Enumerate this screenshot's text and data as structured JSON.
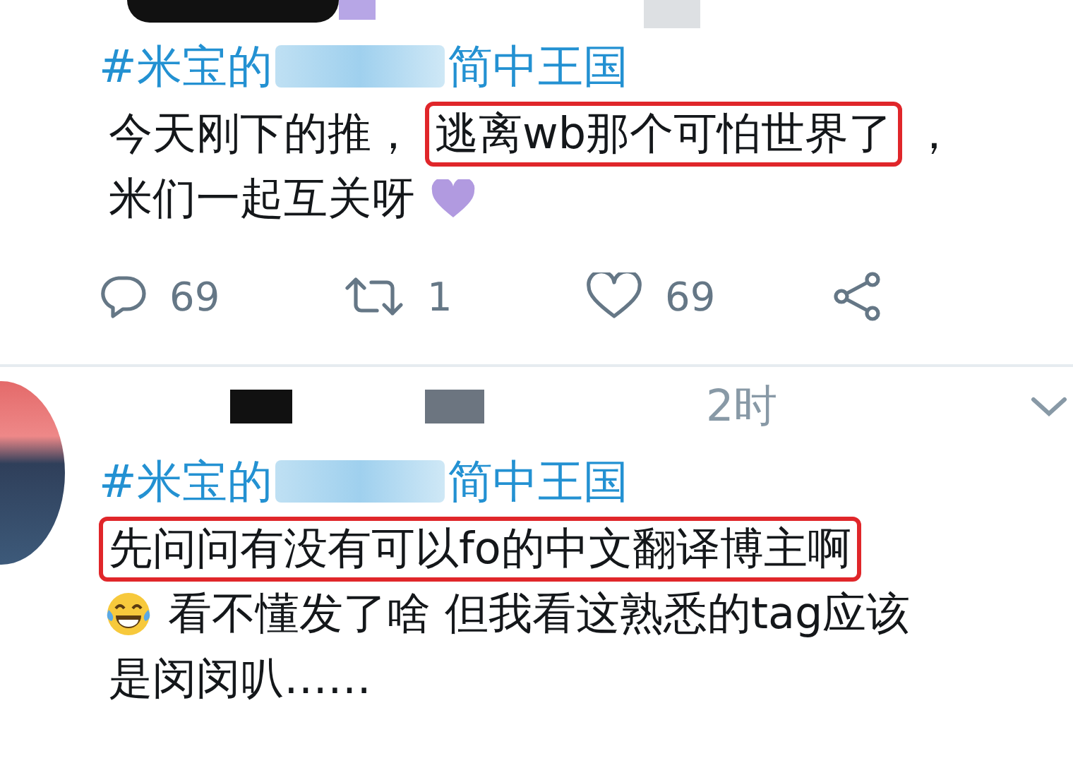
{
  "tweets": [
    {
      "hashtag_start": "#米宝的",
      "hashtag_end": "简中王国",
      "lines": [
        {
          "segments": [
            {
              "kind": "text",
              "text": "今天刚下的推，",
              "highlighted": false
            },
            {
              "kind": "text",
              "text": "逃离wb那个可怕世界了",
              "highlighted": true
            },
            {
              "kind": "text",
              "text": "，",
              "highlighted": false
            }
          ]
        },
        {
          "segments": [
            {
              "kind": "text",
              "text": "米们一起互关呀",
              "highlighted": false
            },
            {
              "kind": "heart"
            }
          ]
        }
      ],
      "actions": {
        "replies": "69",
        "retweets": "1",
        "likes": "69"
      }
    },
    {
      "time": "2时",
      "hashtag_start": "#米宝的",
      "hashtag_end": "简中王国",
      "lines": [
        {
          "segments": [
            {
              "kind": "text",
              "text": "先问问有没有可以fo的中文翻译博主啊",
              "highlighted": true
            }
          ]
        },
        {
          "segments": [
            {
              "kind": "laugh"
            },
            {
              "kind": "text",
              "text": "看不懂发了啥 但我看这熟悉的tag应该",
              "highlighted": false
            }
          ]
        },
        {
          "segments": [
            {
              "kind": "text",
              "text": "是闵闵叭……",
              "highlighted": false
            }
          ]
        }
      ]
    }
  ]
}
